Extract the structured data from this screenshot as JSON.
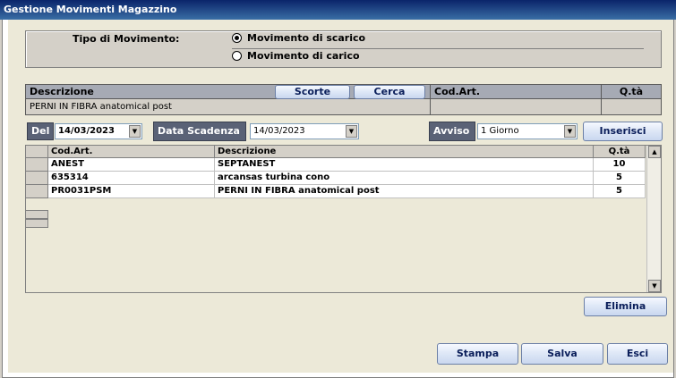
{
  "window": {
    "title": "Gestione Movimenti Magazzino"
  },
  "tipo": {
    "label": "Tipo di Movimento:",
    "options": [
      {
        "label": "Movimento di scarico",
        "selected": true
      },
      {
        "label": "Movimento di carico",
        "selected": false
      }
    ]
  },
  "header": {
    "descrizione_label": "Descrizione",
    "scorte_label": "Scorte",
    "cerca_label": "Cerca",
    "codart_label": "Cod.Art.",
    "qta_label": "Q.tà",
    "descrizione_value": "PERNI IN FIBRA anatomical post",
    "codart_value": "",
    "qta_value": ""
  },
  "filters": {
    "del_label": "Del",
    "del_value": "14/03/2023",
    "scadenza_label": "Data Scadenza",
    "scadenza_value": "14/03/2023",
    "avviso_label": "Avviso",
    "avviso_value": "1 Giorno",
    "inserisci_label": "Inserisci"
  },
  "grid": {
    "columns": [
      "Cod.Art.",
      "Descrizione",
      "Q.tà"
    ],
    "rows": [
      {
        "cod": "ANEST",
        "desc": "SEPTANEST",
        "qta": "10"
      },
      {
        "cod": "635314",
        "desc": "arcansas turbina cono",
        "qta": "5"
      },
      {
        "cod": "PR0031PSM",
        "desc": "PERNI IN FIBRA anatomical post",
        "qta": "5"
      }
    ]
  },
  "actions": {
    "elimina_label": "Elimina",
    "stampa_label": "Stampa",
    "salva_label": "Salva",
    "esci_label": "Esci"
  },
  "colors": {
    "titlebar": "#0a246a",
    "label_bg": "#5a6276",
    "panel": "#ece9d8"
  },
  "icons": {
    "scroll_up": "up-arrow-icon",
    "scroll_down": "down-arrow-icon",
    "combo": "chevron-down-icon"
  }
}
